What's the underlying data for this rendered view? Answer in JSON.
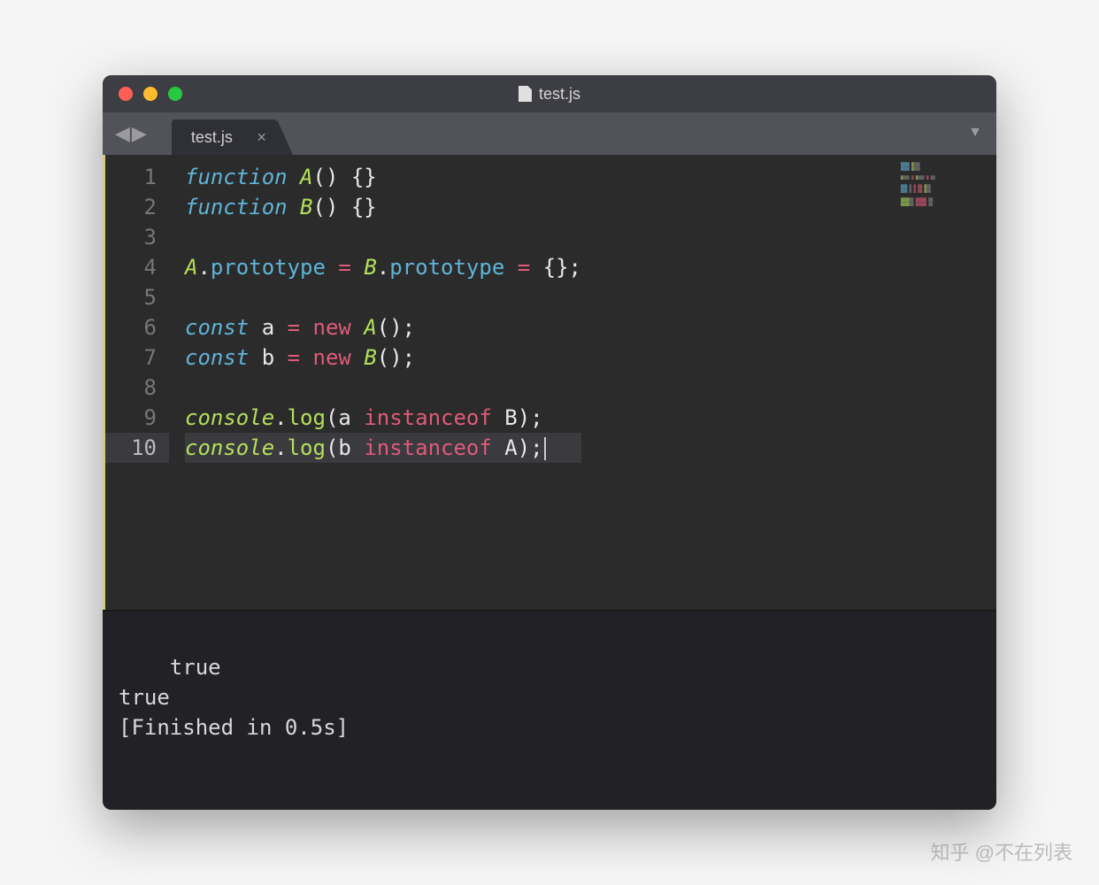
{
  "window": {
    "title": "test.js"
  },
  "tab": {
    "name": "test.js"
  },
  "gutter": {
    "lines": [
      "1",
      "2",
      "3",
      "4",
      "5",
      "6",
      "7",
      "8",
      "9",
      "10"
    ],
    "activeLine": 10
  },
  "code": {
    "lines": [
      [
        {
          "t": "function ",
          "c": "kw"
        },
        {
          "t": "A",
          "c": "fn"
        },
        {
          "t": "() {}",
          "c": "p"
        }
      ],
      [
        {
          "t": "function ",
          "c": "kw"
        },
        {
          "t": "B",
          "c": "fn"
        },
        {
          "t": "() {}",
          "c": "p"
        }
      ],
      [],
      [
        {
          "t": "A",
          "c": "fn"
        },
        {
          "t": ".",
          "c": "p"
        },
        {
          "t": "prototype",
          "c": "prop"
        },
        {
          "t": " = ",
          "c": "op"
        },
        {
          "t": "B",
          "c": "fn"
        },
        {
          "t": ".",
          "c": "p"
        },
        {
          "t": "prototype",
          "c": "prop"
        },
        {
          "t": " = ",
          "c": "op"
        },
        {
          "t": "{};",
          "c": "p"
        }
      ],
      [],
      [
        {
          "t": "const ",
          "c": "kw"
        },
        {
          "t": "a",
          "c": "var"
        },
        {
          "t": " = ",
          "c": "op"
        },
        {
          "t": "new ",
          "c": "op"
        },
        {
          "t": "A",
          "c": "fn"
        },
        {
          "t": "();",
          "c": "p"
        }
      ],
      [
        {
          "t": "const ",
          "c": "kw"
        },
        {
          "t": "b",
          "c": "var"
        },
        {
          "t": " = ",
          "c": "op"
        },
        {
          "t": "new ",
          "c": "op"
        },
        {
          "t": "B",
          "c": "fn"
        },
        {
          "t": "();",
          "c": "p"
        }
      ],
      [],
      [
        {
          "t": "console",
          "c": "fn"
        },
        {
          "t": ".",
          "c": "p"
        },
        {
          "t": "log",
          "c": "id"
        },
        {
          "t": "(a ",
          "c": "p"
        },
        {
          "t": "instanceof",
          "c": "op"
        },
        {
          "t": " B);",
          "c": "p"
        }
      ],
      [
        {
          "t": "console",
          "c": "fn"
        },
        {
          "t": ".",
          "c": "p"
        },
        {
          "t": "log",
          "c": "id"
        },
        {
          "t": "(b ",
          "c": "p"
        },
        {
          "t": "instanceof",
          "c": "op"
        },
        {
          "t": " A);",
          "c": "p"
        }
      ]
    ]
  },
  "console": {
    "output": "true\ntrue\n[Finished in 0.5s]"
  },
  "watermark": "知乎 @不在列表"
}
